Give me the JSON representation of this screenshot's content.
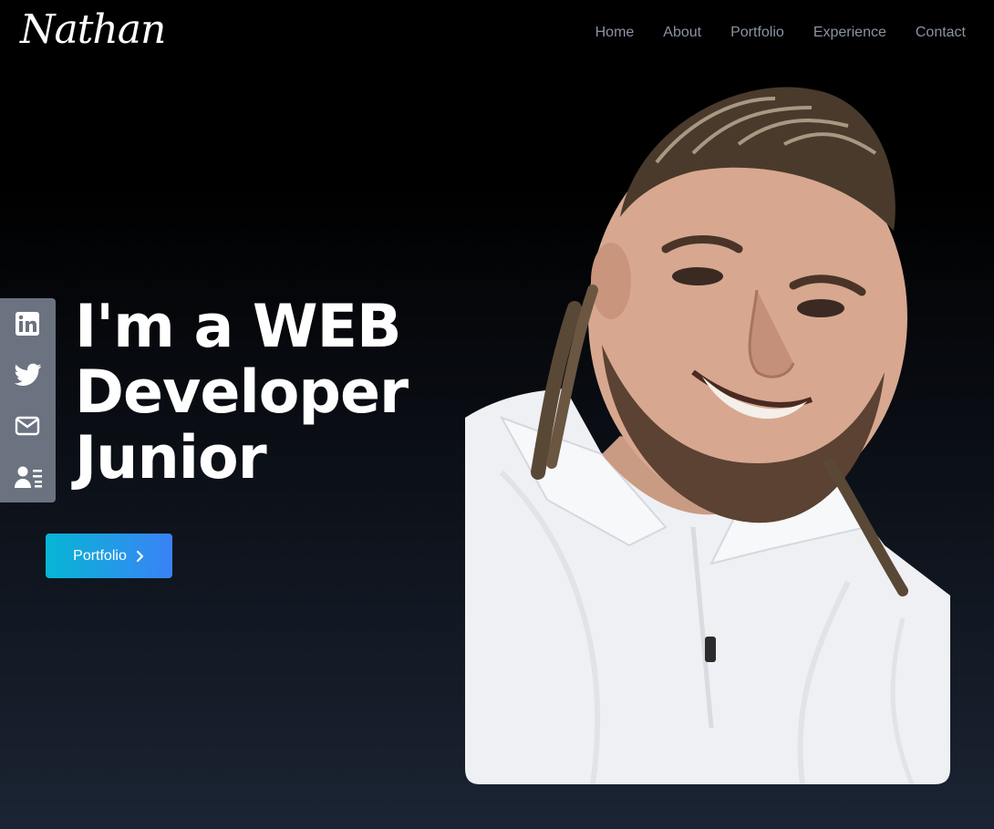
{
  "header": {
    "logo_text": "Nathan",
    "nav": [
      {
        "label": "Home"
      },
      {
        "label": "About"
      },
      {
        "label": "Portfolio"
      },
      {
        "label": "Experience"
      },
      {
        "label": "Contact"
      }
    ]
  },
  "social": {
    "icons": [
      "linkedin-icon",
      "twitter-icon",
      "mail-icon",
      "resume-icon"
    ]
  },
  "hero": {
    "headline_lines": [
      "I'm a WEB",
      "Developer",
      "Junior"
    ],
    "cta_label": "Portfolio",
    "cta_icon": "chevron-right-icon"
  },
  "colors": {
    "cta_gradient_start": "#06b6d4",
    "cta_gradient_end": "#3b82f6",
    "nav_text": "#8b93a3",
    "social_bar": "#6b7280"
  }
}
